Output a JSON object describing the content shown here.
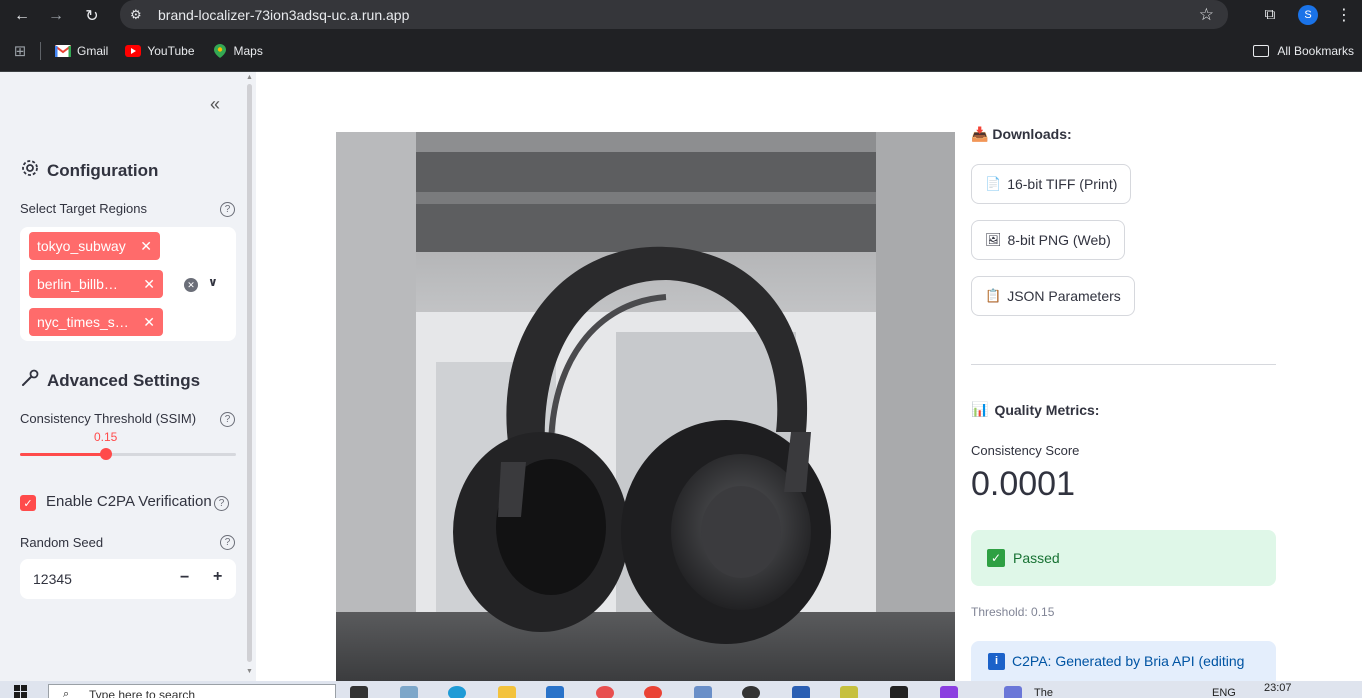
{
  "browser": {
    "url": "brand-localizer-73ion3adsq-uc.a.run.app",
    "profile_initial": "S",
    "bookmarks": [
      {
        "label": "Gmail",
        "icon": "gmail-icon"
      },
      {
        "label": "YouTube",
        "icon": "youtube-icon"
      },
      {
        "label": "Maps",
        "icon": "maps-icon"
      }
    ],
    "all_bookmarks": "All Bookmarks"
  },
  "sidebar": {
    "config_title": "Configuration",
    "regions_label": "Select Target Regions",
    "regions": [
      "tokyo_subway",
      "berlin_billb…",
      "nyc_times_s…"
    ],
    "advanced_title": "Advanced Settings",
    "ssim_label": "Consistency Threshold (SSIM)",
    "ssim_value": "0.15",
    "ssim_fraction": 0.4,
    "c2pa_label": "Enable C2PA Verification",
    "c2pa_checked": true,
    "seed_label": "Random Seed",
    "seed_value": "12345"
  },
  "main": {
    "downloads_title": "Downloads:",
    "downloads": [
      {
        "label": "16-bit TIFF (Print)",
        "icon": "📄"
      },
      {
        "label": "8-bit PNG (Web)",
        "icon": "🖼"
      },
      {
        "label": "JSON Parameters",
        "icon": "📋"
      }
    ],
    "quality_title": "Quality Metrics:",
    "quality_icon": "📊",
    "consistency_label": "Consistency Score",
    "consistency_value": "0.0001",
    "status": "Passed",
    "threshold_text": "Threshold: 0.15",
    "c2pa_info": "C2PA: Generated by Bria API (editing"
  },
  "taskbar": {
    "search_placeholder": "Type here to search",
    "item_label": "The",
    "lang": "ENG",
    "time": "23:07"
  },
  "colors": {
    "accent": "#ff4b4b",
    "chip": "#ff6b6b",
    "sidebar_bg": "#f0f2f6",
    "success_bg": "#dff7e8",
    "info_bg": "#e4eefc"
  }
}
